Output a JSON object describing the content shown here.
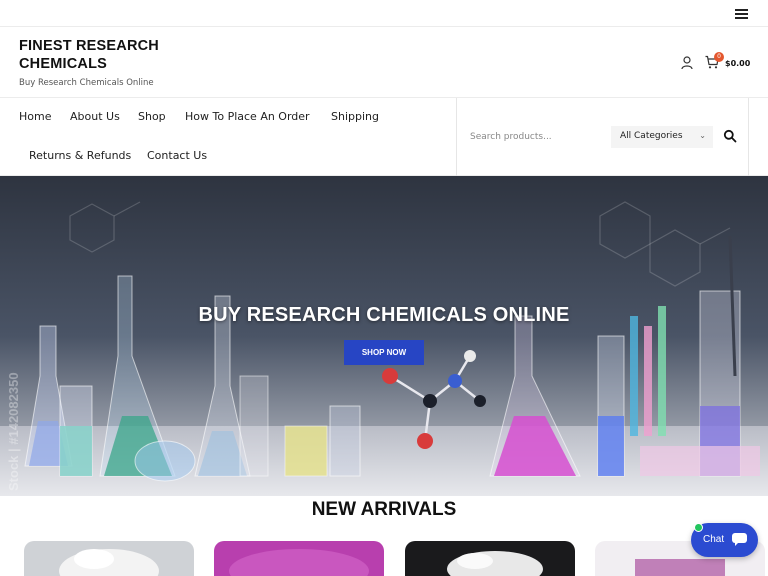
{
  "site": {
    "title": "FINEST RESEARCH CHEMICALS",
    "tagline": "Buy Research Chemicals Online"
  },
  "header": {
    "cart_count": "0",
    "cart_total": "$0.00"
  },
  "nav": {
    "items": [
      {
        "label": "Home"
      },
      {
        "label": "About Us"
      },
      {
        "label": "Shop"
      },
      {
        "label": "How To Place An Order"
      },
      {
        "label": "Shipping"
      },
      {
        "label": "Returns & Refunds"
      },
      {
        "label": "Contact Us"
      }
    ]
  },
  "search": {
    "placeholder": "Search products...",
    "category": "All Categories"
  },
  "hero": {
    "title": "BUY RESEARCH CHEMICALS ONLINE",
    "button": "SHOP NOW",
    "watermark": "Stock | #142082350"
  },
  "section": {
    "new_arrivals": "NEW ARRIVALS"
  },
  "chat": {
    "label": "Chat"
  },
  "colors": {
    "accent": "#2745c4",
    "badge": "#e4572e",
    "online": "#22c55e"
  },
  "icons": [
    "menu-icon",
    "user-icon",
    "cart-icon",
    "search-icon",
    "chevron-down-icon",
    "chat-bubble-icon"
  ]
}
